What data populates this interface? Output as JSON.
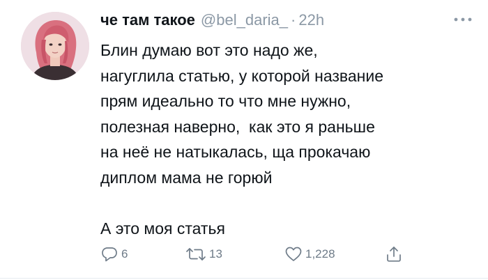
{
  "tweet": {
    "display_name": "че там такое",
    "handle": "@bel_daria_",
    "separator": "·",
    "time": "22h",
    "body_lines": [
      "Блин думаю вот это надо же,",
      "нагуглила статью, у которой название",
      "прям идеально то что мне нужно,",
      "полезная наверно,  как это я раньше",
      "на неё не натыкалась, ща прокачаю",
      "диплом мама не горюй",
      "",
      "А это моя статья"
    ]
  },
  "actions": {
    "reply_count": "6",
    "retweet_count": "13",
    "like_count": "1,228"
  },
  "icons": {
    "more": "more-dots-icon",
    "reply": "reply-icon",
    "retweet": "retweet-icon",
    "like": "heart-icon",
    "share": "share-icon"
  },
  "colors": {
    "text": "#0f1419",
    "secondary": "#8b98a5",
    "action": "#6e7b88",
    "divider": "#e6ecf0"
  }
}
